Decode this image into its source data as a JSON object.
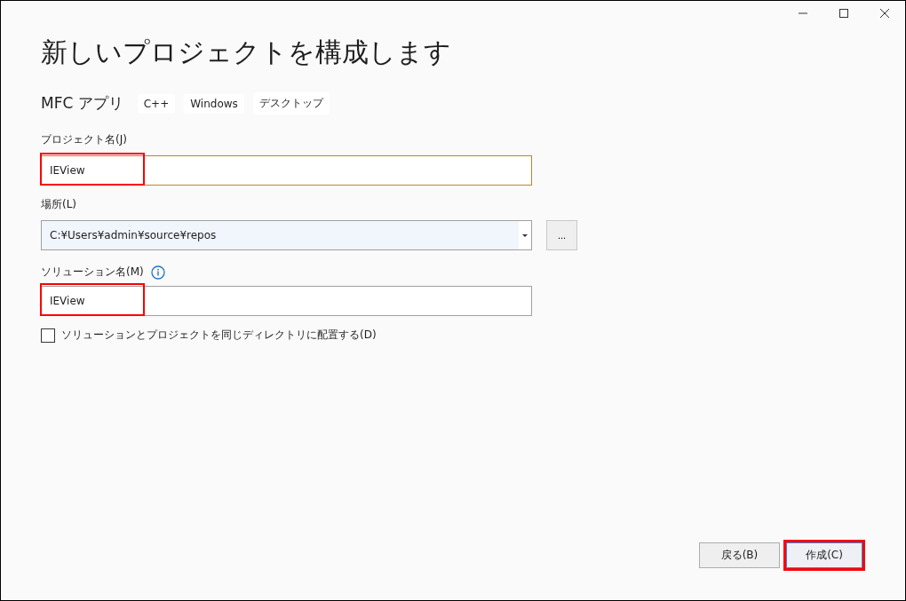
{
  "window": {
    "controls": [
      {
        "kind": "minimize"
      },
      {
        "kind": "maximize"
      },
      {
        "kind": "close"
      }
    ]
  },
  "title": "新しいプロジェクトを構成します",
  "template": {
    "name": "MFC アプリ",
    "tags": [
      "C++",
      "Windows",
      "デスクトップ"
    ]
  },
  "project_name": {
    "label": "プロジェクト名(J)",
    "value": "IEView",
    "highlighted": true
  },
  "location": {
    "label": "場所(L)",
    "value": "C:¥Users¥admin¥source¥repos",
    "browse": "..."
  },
  "solution_name": {
    "label": "ソリューション名(M)",
    "value": "IEView",
    "highlighted": true
  },
  "same_directory": {
    "label": "ソリューションとプロジェクトを同じディレクトリに配置する(D)",
    "checked": false
  },
  "buttons": [
    {
      "label": "戻る(B)",
      "primary": false,
      "highlighted": false
    },
    {
      "label": "作成(C)",
      "primary": true,
      "highlighted": true
    }
  ]
}
